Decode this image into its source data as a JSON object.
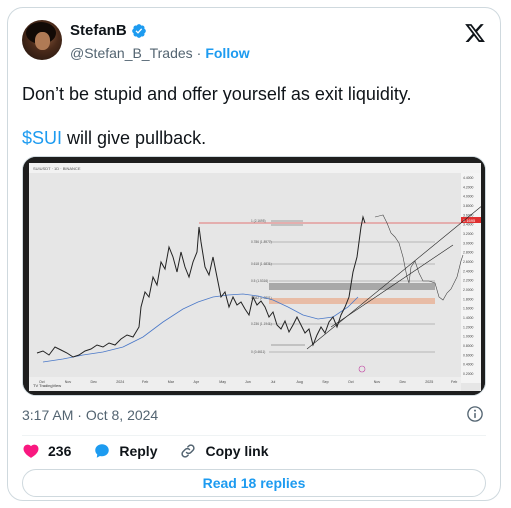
{
  "author": {
    "display_name": "StefanB",
    "handle": "@Stefan_B_Trades",
    "separator": "·",
    "follow_label": "Follow"
  },
  "tweet": {
    "line1": "Don’t be stupid and offer yourself as exit liquidity.",
    "cashtag": "$SUI",
    "line2_rest": " will give pullback."
  },
  "media": {
    "chart_y_ticks": [
      "4.4000",
      "4.2000",
      "4.0000",
      "3.8000",
      "3.6000",
      "3.4000",
      "3.2000",
      "3.0000",
      "2.8000",
      "2.6000",
      "2.4000",
      "2.2000",
      "2.0000",
      "1.8000",
      "1.6000",
      "1.4000",
      "1.2000",
      "1.0000",
      "0.8000",
      "0.6000",
      "0.4000",
      "0.2000"
    ],
    "chart_x_ticks": [
      "Oct",
      "Nov",
      "Dec",
      "2024",
      "Feb",
      "Mar",
      "Apr",
      "May",
      "Jun",
      "Jul",
      "Aug",
      "Sep",
      "Oct",
      "Nov",
      "Dec",
      "2025",
      "Feb"
    ],
    "fib_labels": [
      "1 (2.1695)",
      "0.786 (1.8977)",
      "0.618 (1.6831)",
      "0.5 (1.5316)",
      "0.382 (1.3801)",
      "0.236 (1.1941)",
      "0 (0.4611)"
    ],
    "watermark": "TV TradingView",
    "price_tag": "2.1695",
    "header_text": "SUIUSDT · 1D · BINANCE"
  },
  "meta": {
    "time": "3:17 AM",
    "dot": "·",
    "date": "Oct 8, 2024"
  },
  "actions": {
    "likes": "236",
    "reply_label": "Reply",
    "copy_link_label": "Copy link"
  },
  "read_replies_label": "Read 18 replies",
  "colors": {
    "accent": "#1d9bf0",
    "like": "#f91880",
    "text": "#0f1419",
    "secondary": "#536471"
  }
}
